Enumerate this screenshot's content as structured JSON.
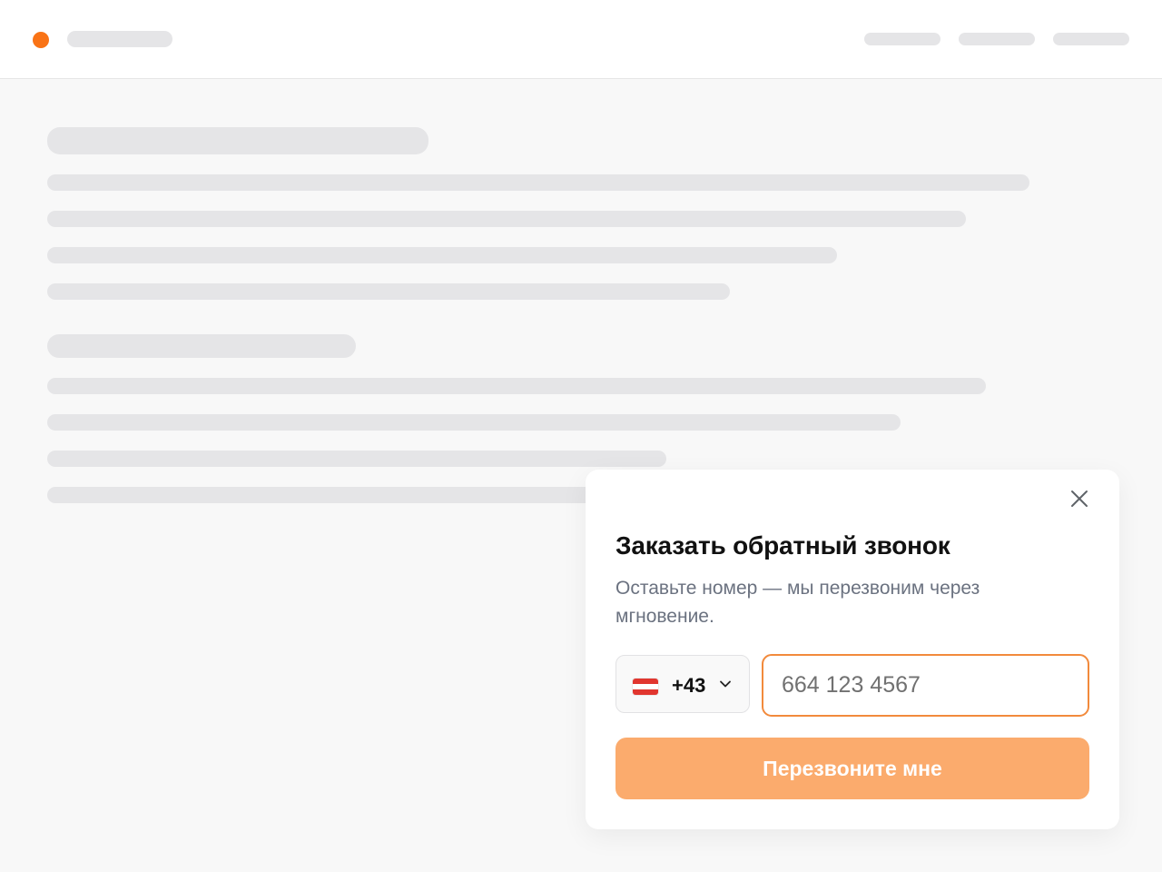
{
  "colors": {
    "accent": "#f97316",
    "skeleton": "#e5e5e7",
    "page_background": "#f8f8f8",
    "input_border": "#f28a3c",
    "button_background": "#fbab6d",
    "subtitle_text": "#6b7280"
  },
  "header": {
    "logo_icon": "orange-dot",
    "nav_items_count": 3
  },
  "popup": {
    "close_icon": "close-icon",
    "title": "Заказать обратный звонок",
    "subtitle": "Оставьте номер — мы перезвоним через мгновение.",
    "country": {
      "flag_icon": "austria-flag-icon",
      "dial_code": "+43"
    },
    "phone": {
      "value": "",
      "placeholder": "664 123 4567"
    },
    "submit_label": "Перезвоните мне"
  }
}
